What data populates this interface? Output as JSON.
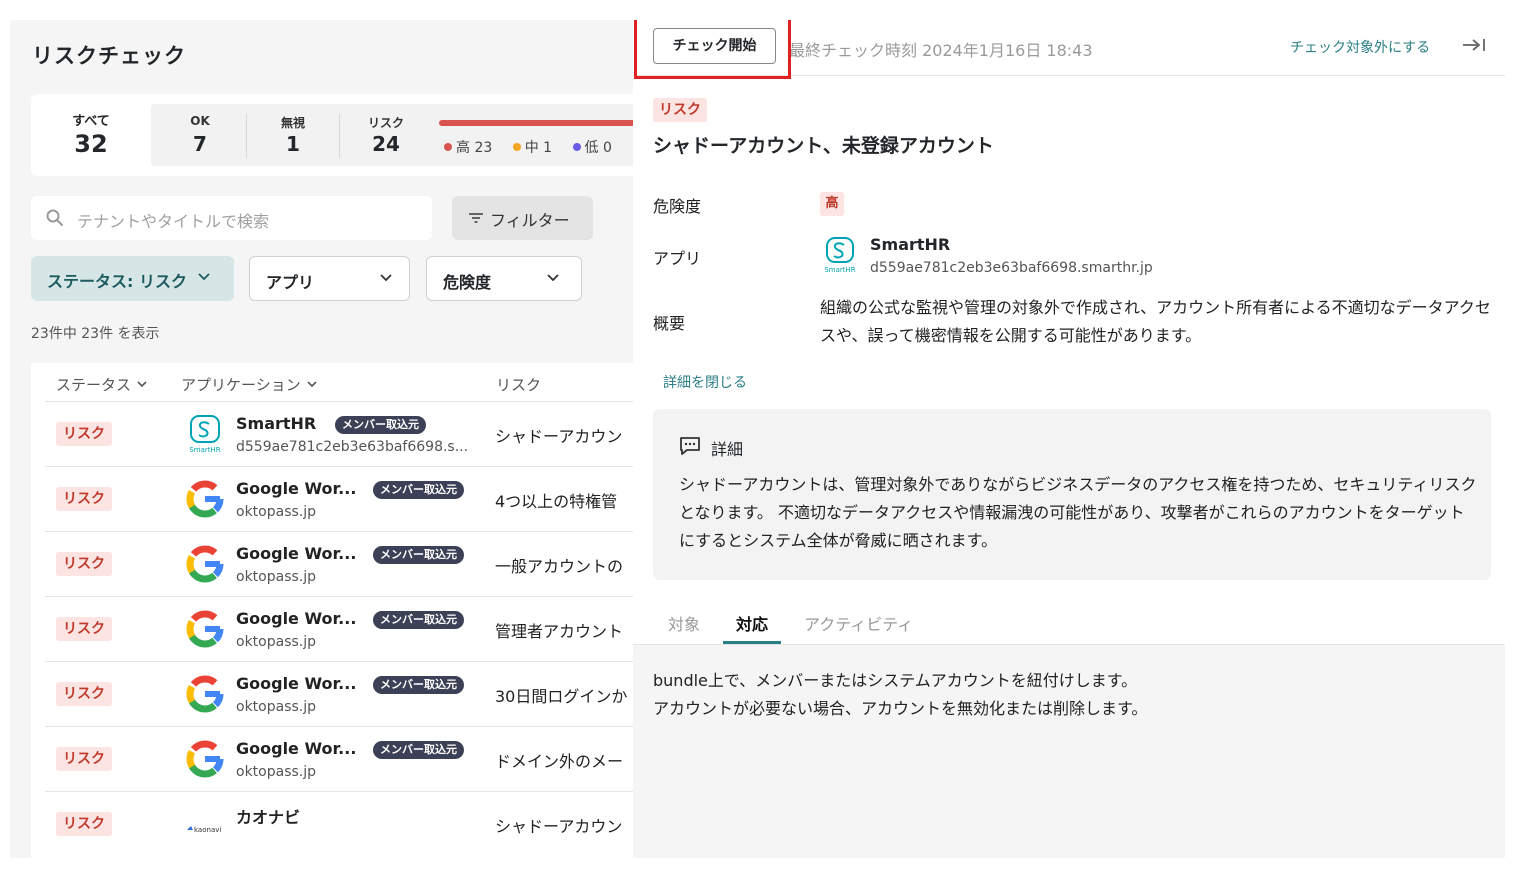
{
  "page_title": "リスクチェック",
  "summary": {
    "all_label": "すべて",
    "all_count": "32",
    "ok_label": "OK",
    "ok_count": "7",
    "ignore_label": "無視",
    "ignore_count": "1",
    "risk_label": "リスク",
    "risk_count": "24",
    "severities": [
      {
        "label": "高 23",
        "color": "#d9534f"
      },
      {
        "label": "中 1",
        "color": "#f5a623"
      },
      {
        "label": "低 0",
        "color": "#6c5ce7"
      }
    ]
  },
  "search": {
    "placeholder": "テナントやタイトルで検索",
    "icon": "search-icon"
  },
  "filter_button": {
    "label": "フィルター",
    "icon": "filter-icon"
  },
  "chips": {
    "status": "ステータス: リスク",
    "app": "アプリ",
    "risk": "危険度"
  },
  "count_text": "23件中 23件 を表示",
  "table": {
    "headers": {
      "status": "ステータス",
      "app": "アプリケーション",
      "risk": "リスク"
    },
    "rows": [
      {
        "status": "リスク",
        "app": "SmartHR",
        "sub": "d559ae781c2eb3e63baf6698.s...",
        "tag": "メンバー取込元",
        "risk": "シャドーアカウン",
        "icon": "smarthr"
      },
      {
        "status": "リスク",
        "app": "Google Wor...",
        "sub": "oktopass.jp",
        "tag": "メンバー取込元",
        "risk": "4つ以上の特権管",
        "icon": "google"
      },
      {
        "status": "リスク",
        "app": "Google Wor...",
        "sub": "oktopass.jp",
        "tag": "メンバー取込元",
        "risk": "一般アカウントの",
        "icon": "google"
      },
      {
        "status": "リスク",
        "app": "Google Wor...",
        "sub": "oktopass.jp",
        "tag": "メンバー取込元",
        "risk": "管理者アカウント",
        "icon": "google"
      },
      {
        "status": "リスク",
        "app": "Google Wor...",
        "sub": "oktopass.jp",
        "tag": "メンバー取込元",
        "risk": "30日間ログインか",
        "icon": "google"
      },
      {
        "status": "リスク",
        "app": "Google Wor...",
        "sub": "oktopass.jp",
        "tag": "メンバー取込元",
        "risk": "ドメイン外のメー",
        "icon": "google"
      },
      {
        "status": "リスク",
        "app": "カオナビ",
        "sub": "",
        "tag": "",
        "risk": "シャドーアカウン",
        "icon": "kaonavi"
      }
    ]
  },
  "detail": {
    "start_button": "チェック開始",
    "last_check": "最終チェック時刻 2024年1月16日 18:43",
    "exclude_link": "チェック対象外にする",
    "risk_tag": "リスク",
    "title": "シャドーアカウント、未登録アカウント",
    "severity_label": "危険度",
    "severity_value": "高",
    "app_label": "アプリ",
    "app_name": "SmartHR",
    "app_domain": "d559ae781c2eb3e63baf6698.smarthr.jp",
    "summary_label": "概要",
    "summary_text": "組織の公式な監視や管理の対象外で作成され、アカウント所有者による不適切なデータアクセスや、誤って機密情報を公開する可能性があります。",
    "close_link": "詳細を閉じる",
    "detail_heading": "詳細",
    "detail_body": "シャドーアカウントは、管理対象外でありながらビジネスデータのアクセス権を持つため、セキュリティリスクとなります。 不適切なデータアクセスや情報漏洩の可能性があり、攻撃者がこれらのアカウントをターゲットにするとシステム全体が脅威に晒されます。",
    "tabs": [
      "対象",
      "対応",
      "アクティビティ"
    ],
    "active_tab": "対応",
    "tab_content": [
      "bundle上で、メンバーまたはシステムアカウントを紐付けします。",
      "アカウントが必要ない場合、アカウントを無効化または削除します。"
    ]
  },
  "colors": {
    "accent": "#2a7f86",
    "risk": "#c0392b",
    "risk_bg": "#fbe4e2",
    "highlight": "#e02020"
  }
}
